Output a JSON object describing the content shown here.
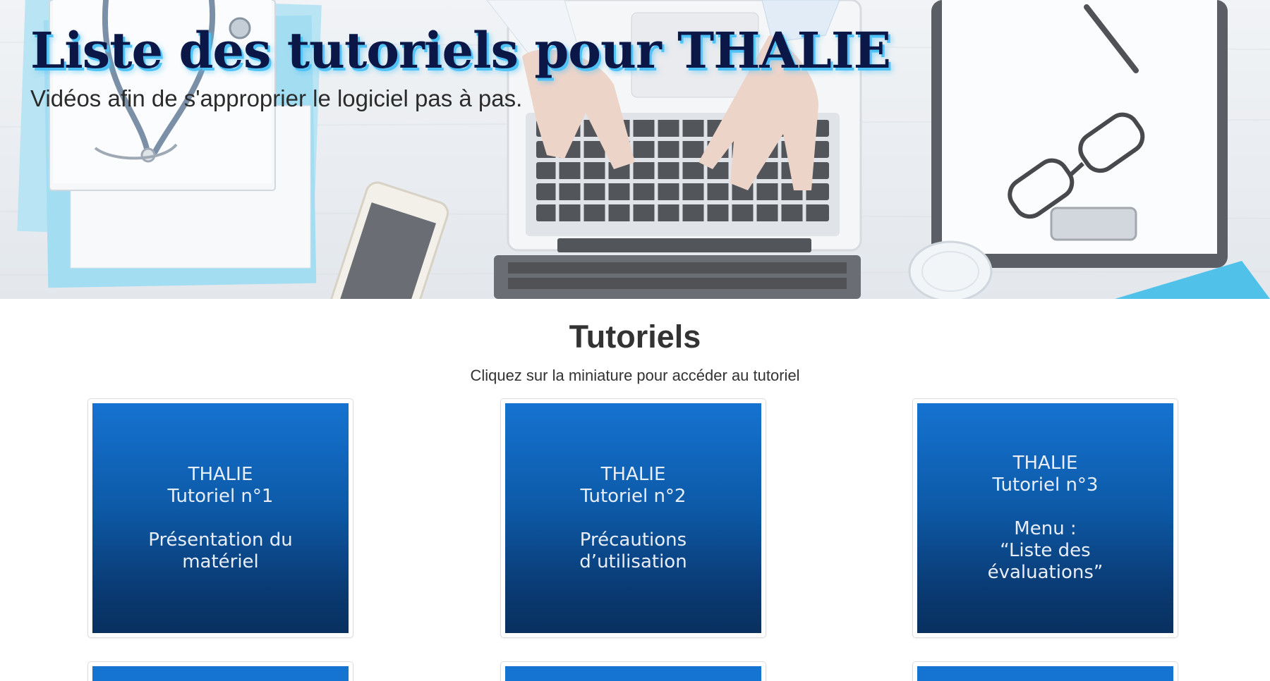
{
  "hero": {
    "title": "Liste des tutoriels pour THALIE",
    "subtitle": "Vidéos afin de s'approprier le logiciel pas à pas."
  },
  "section": {
    "title": "Tutoriels",
    "hint": "Cliquez sur la miniature pour accéder au tutoriel"
  },
  "tutorials": [
    {
      "lines": [
        "THALIE",
        "Tutoriel n°1",
        "",
        "Présentation du",
        "matériel"
      ]
    },
    {
      "lines": [
        "THALIE",
        "Tutoriel n°2",
        "",
        "Précautions",
        "d’utilisation"
      ]
    },
    {
      "lines": [
        "THALIE",
        "Tutoriel n°3",
        "",
        "Menu :",
        "“Liste des",
        "évaluations”"
      ]
    }
  ],
  "colors": {
    "title_text": "#0b1746",
    "title_glow": "#4fc3f7",
    "thumb_top": "#1573d1",
    "thumb_bottom": "#08305f"
  },
  "icons": {
    "hero_photo": "desk-with-laptop-stethoscope-clipboard-glasses-photo"
  }
}
